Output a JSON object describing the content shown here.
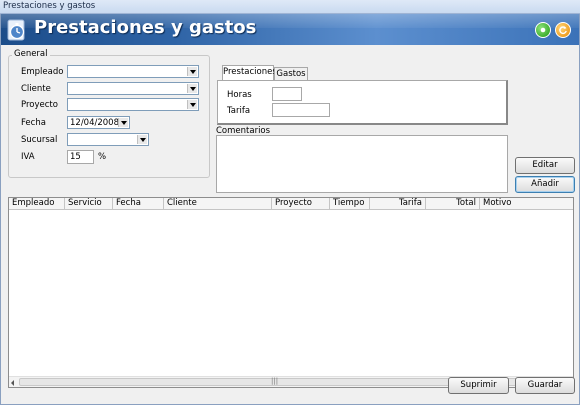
{
  "window_title": "Prestaciones y gastos",
  "header": {
    "title": "Prestaciones y gastos"
  },
  "general": {
    "legend": "General",
    "empleado_label": "Empleado",
    "cliente_label": "Cliente",
    "proyecto_label": "Proyecto",
    "fecha_label": "Fecha",
    "fecha_value": "12/04/2008",
    "sucursal_label": "Sucursal",
    "iva_label": "IVA",
    "iva_value": "15",
    "iva_unit": "%"
  },
  "tabs": [
    {
      "label": "Prestaciones",
      "active": true
    },
    {
      "label": "Gastos",
      "active": false
    }
  ],
  "prestaciones": {
    "horas_label": "Horas",
    "tarifa_label": "Tarifa"
  },
  "comentarios_label": "Comentarios",
  "buttons": {
    "editar": "Editar",
    "anadir": "Añadir",
    "suprimir": "Suprimir",
    "guardar": "Guardar"
  },
  "table": {
    "columns": [
      "Empleado",
      "Servicio",
      "Fecha",
      "Cliente",
      "Proyecto",
      "Tiempo",
      "Tarifa",
      "Total",
      "Motivo"
    ],
    "rows": []
  },
  "colors": {
    "header_blue": "#2f64a6",
    "accent_green": "#1f9a12",
    "accent_orange": "#e98a00"
  }
}
